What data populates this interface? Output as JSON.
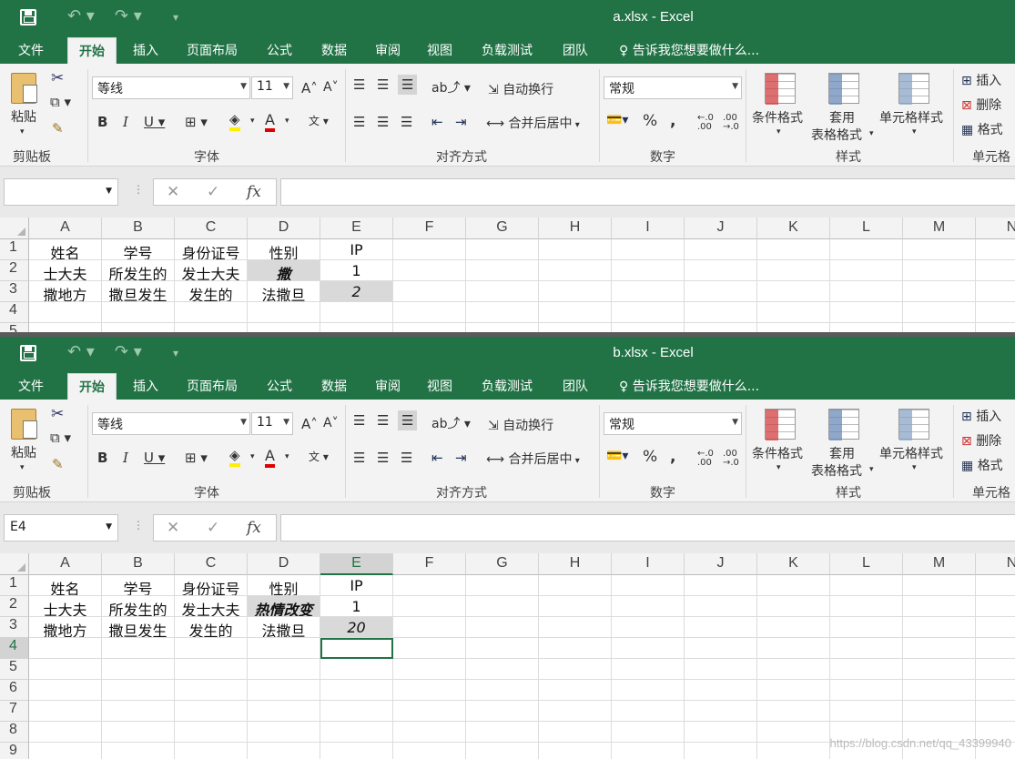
{
  "windows": [
    {
      "id": "a",
      "title": "a.xlsx - Excel",
      "tabs": [
        "文件",
        "开始",
        "插入",
        "页面布局",
        "公式",
        "数据",
        "审阅",
        "视图",
        "负载测试",
        "团队"
      ],
      "active_tab": "开始",
      "tell_me": "告诉我您想要做什么...",
      "ribbon": {
        "paste": "粘贴",
        "clipboard": "剪贴板",
        "font_name": "等线",
        "font_size": "11",
        "font_group": "字体",
        "wrap": "自动换行",
        "merge": "合并后居中",
        "align_group": "对齐方式",
        "number_format": "常规",
        "number_group": "数字",
        "cond_format": "条件格式",
        "table_format_1": "套用",
        "table_format_2": "表格格式",
        "cell_style": "单元格样式",
        "style_group": "样式",
        "insert": "插入",
        "delete": "删除",
        "format": "格式",
        "cells_group": "单元格"
      },
      "name_box": "",
      "columns": [
        "A",
        "B",
        "C",
        "D",
        "E",
        "F",
        "G",
        "H",
        "I",
        "J",
        "K",
        "L",
        "M",
        "N"
      ],
      "rows": [
        "1",
        "2",
        "3",
        "4",
        "5"
      ],
      "cells": [
        [
          "姓名",
          "学号",
          "身份证号",
          "性别",
          "IP"
        ],
        [
          "士大夫",
          "所发生的",
          "发士大夫",
          "撒",
          "1"
        ],
        [
          "撒地方",
          "撒旦发生",
          "发生的",
          "法撒旦",
          "2"
        ]
      ]
    },
    {
      "id": "b",
      "title": "b.xlsx - Excel",
      "tabs": [
        "文件",
        "开始",
        "插入",
        "页面布局",
        "公式",
        "数据",
        "审阅",
        "视图",
        "负载测试",
        "团队"
      ],
      "active_tab": "开始",
      "tell_me": "告诉我您想要做什么...",
      "ribbon": {
        "paste": "粘贴",
        "clipboard": "剪贴板",
        "font_name": "等线",
        "font_size": "11",
        "font_group": "字体",
        "wrap": "自动换行",
        "merge": "合并后居中",
        "align_group": "对齐方式",
        "number_format": "常规",
        "number_group": "数字",
        "cond_format": "条件格式",
        "table_format_1": "套用",
        "table_format_2": "表格格式",
        "cell_style": "单元格样式",
        "style_group": "样式",
        "insert": "插入",
        "delete": "删除",
        "format": "格式",
        "cells_group": "单元格"
      },
      "name_box": "E4",
      "columns": [
        "A",
        "B",
        "C",
        "D",
        "E",
        "F",
        "G",
        "H",
        "I",
        "J",
        "K",
        "L",
        "M",
        "N"
      ],
      "rows": [
        "1",
        "2",
        "3",
        "4",
        "5",
        "6",
        "7",
        "8",
        "9"
      ],
      "cells": [
        [
          "姓名",
          "学号",
          "身份证号",
          "性别",
          "IP"
        ],
        [
          "士大夫",
          "所发生的",
          "发士大夫",
          "热情改变",
          "1"
        ],
        [
          "撒地方",
          "撒旦发生",
          "发生的",
          "法撒旦",
          "20"
        ]
      ]
    }
  ],
  "watermark": "https://blog.csdn.net/qq_43399940",
  "colors": {
    "excel_green": "#217346",
    "changed_cell": "#d9d9d9",
    "font_color_bar": "#e00000",
    "fill_color_bar": "#ffee00"
  }
}
